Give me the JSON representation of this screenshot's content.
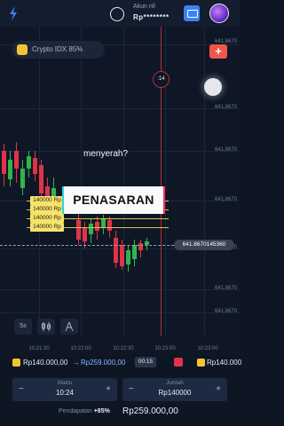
{
  "header": {
    "account_label": "Akun riil",
    "account_amount": "Rp********"
  },
  "chart": {
    "asset_name": "Crypto IDX 85%",
    "countdown": ":14",
    "current_price": "641.8670145360",
    "price_labels": [
      "641,8670",
      "641,8670",
      "641,8670",
      "641,8670",
      "641,8670",
      "641,8670",
      "641,8670"
    ],
    "time_labels": [
      "10:21:30",
      "10:22:00",
      "10:22:30",
      "10:23:00",
      "10:23:00"
    ],
    "trades": [
      "140000 Rp",
      "140000 Rp",
      "140000 Rp",
      "140000 Rp"
    ],
    "overlay_line1": "menyerah?",
    "overlay_banner": "PENASARAN"
  },
  "toolbar": {
    "timeframe_label": "5s"
  },
  "ticker": {
    "investment": "Rp140.000,00",
    "arrow": "→",
    "payout": "Rp259.000,00",
    "timer": "00:15",
    "next_investment": "Rp140.000"
  },
  "trade_panel": {
    "time_label": "Waktu",
    "time_value": "10:24",
    "amount_label": "Jumlah",
    "amount_value": "Rp140000",
    "payout_label": "Pendapatan",
    "payout_percent": "+85%",
    "payout_value": "Rp259.000,00"
  },
  "colors": {
    "background": "#0e1624",
    "up": "#2fb54a",
    "down": "#e0334a",
    "trade_line": "#f8e36a"
  }
}
